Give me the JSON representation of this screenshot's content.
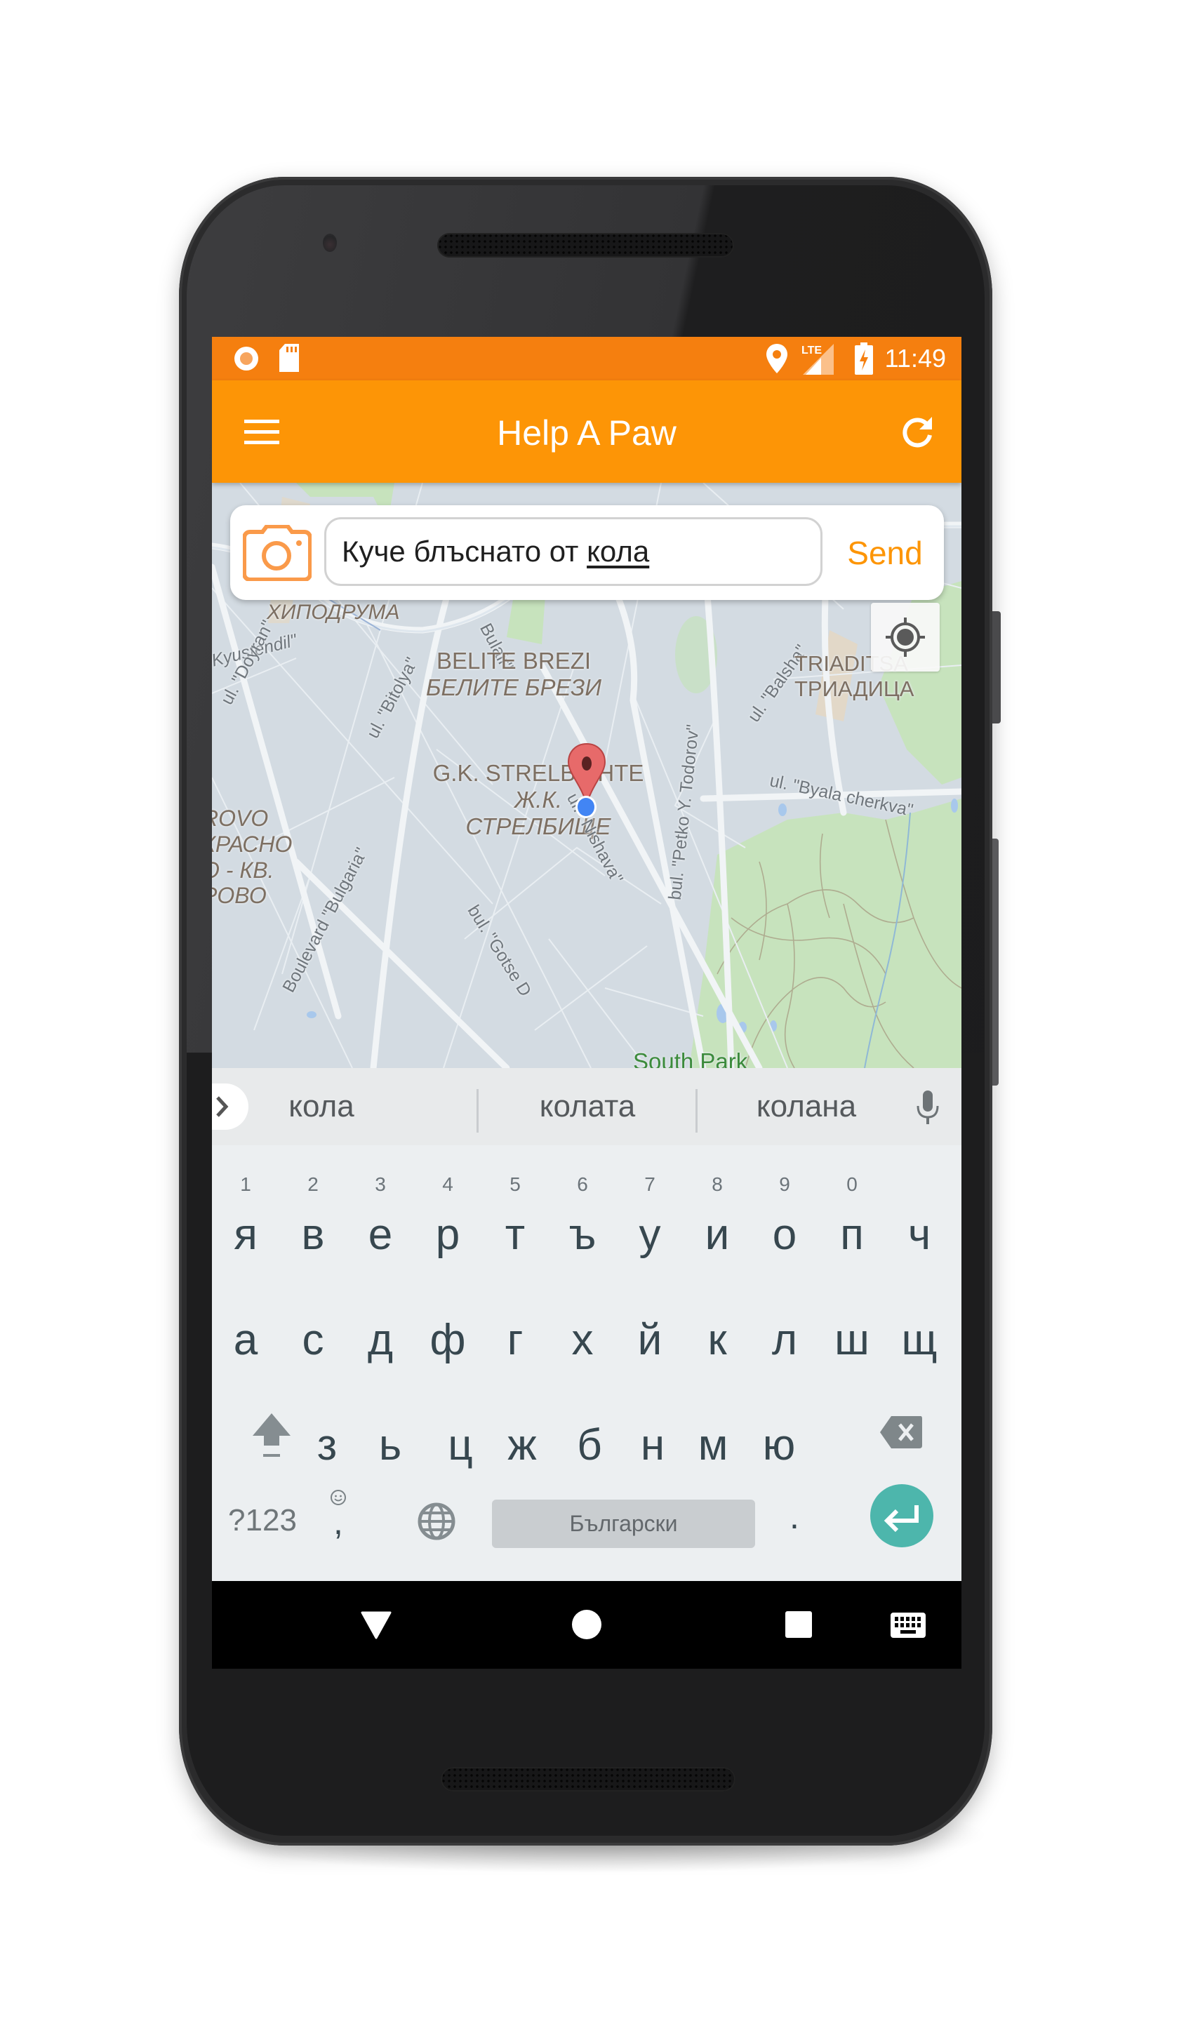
{
  "device": {
    "model_style": "android-phone-dark"
  },
  "status_bar": {
    "left_icons": [
      "record-icon",
      "sd-card-icon"
    ],
    "right_icons": [
      "location-icon",
      "lte-signal-icon",
      "battery-charging-icon"
    ],
    "network_label": "LTE",
    "time": "11:49"
  },
  "toolbar": {
    "title": "Help A Paw",
    "menu_icon": "hamburger-menu-icon",
    "refresh_icon": "refresh-icon",
    "color": "#fd9506"
  },
  "report_card": {
    "camera_icon": "camera-icon",
    "message_prefix": "Куче блъснато от ",
    "message_composing": "кола",
    "send_label": "Send",
    "accent": "#fd9506"
  },
  "map": {
    "my_location_icon": "my-location-icon",
    "labels": {
      "hipodruma": "ХИПОДРУМА",
      "bulair": "Bulair\"",
      "kyustendil": "Kyustendil\"",
      "balsha": "ul. \"Balsha\"",
      "belite_brezi_en": "BELITE BREZI",
      "belite_brezi_bg": "БЕЛИТЕ БРЕЗИ",
      "triaditsa_en": "TRIADITSA",
      "triaditsa_bg": "ТРИАДИЦА",
      "doyran": "ul. \"Doyran\"",
      "bitolya": "ul. \"Bitolya\"",
      "strelbishte_en": "G.K. STRELBISHTE",
      "strelbishte_bg1": "Ж.К.",
      "strelbishte_bg2": "СТРЕЛБИЩЕ",
      "byala_cherkva": "ul. \"Byala cherkva\"",
      "petko_todorov": "bul. \"Petko Y. Todorov\"",
      "nishava": "ul. \"Nishava\"",
      "bulgaria": "Boulevard \"Bulgaria\"",
      "gotse": "bul. \"Gotse D",
      "krasno_1": "ROVO",
      "krasno_2": "КРАСНО",
      "krasno_3": "О - КВ.",
      "krasno_4": "РОВО",
      "park_partial": "South Park"
    },
    "marker_color": "#e25b5b",
    "my_location_dot_color": "#4285f4"
  },
  "keyboard": {
    "suggestions": [
      "кола",
      "колата",
      "колана"
    ],
    "row1": [
      {
        "key": "я",
        "hint": "1"
      },
      {
        "key": "в",
        "hint": "2"
      },
      {
        "key": "е",
        "hint": "3"
      },
      {
        "key": "р",
        "hint": "4"
      },
      {
        "key": "т",
        "hint": "5"
      },
      {
        "key": "ъ",
        "hint": "6"
      },
      {
        "key": "у",
        "hint": "7"
      },
      {
        "key": "и",
        "hint": "8"
      },
      {
        "key": "о",
        "hint": "9"
      },
      {
        "key": "п",
        "hint": "0"
      },
      {
        "key": "ч",
        "hint": ""
      }
    ],
    "row2": [
      "а",
      "с",
      "д",
      "ф",
      "г",
      "х",
      "й",
      "к",
      "л",
      "ш",
      "щ"
    ],
    "row3": [
      "з",
      "ь",
      "ц",
      "ж",
      "б",
      "н",
      "м",
      "ю"
    ],
    "symbols_label": "?123",
    "comma_label": ",",
    "space_label": "Български",
    "period_label": ".",
    "enter_color": "#4db6ac"
  },
  "nav_bar": {
    "back_icon": "back-triangle-icon",
    "home_icon": "home-circle-icon",
    "recents_icon": "recents-square-icon",
    "keyboard_icon": "keyboard-switch-icon"
  }
}
